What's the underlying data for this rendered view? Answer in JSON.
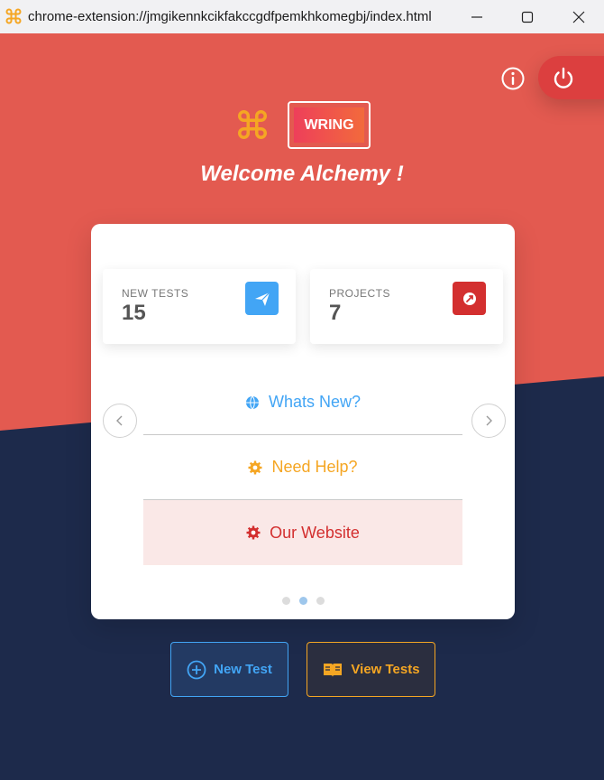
{
  "window": {
    "url": "chrome-extension://jmgikennkcikfakccgdfpemkhkomegbj/index.html",
    "icons": [
      "app-command-icon",
      "minimize-icon",
      "maximize-icon",
      "close-icon"
    ]
  },
  "header": {
    "brand": "WRING",
    "welcome": "Welcome Alchemy !",
    "icons": [
      "info-icon",
      "power-icon",
      "command-logo-icon"
    ]
  },
  "stats": [
    {
      "label": "NEW TESTS",
      "value": "15",
      "icon": "paper-plane-icon",
      "color": "#42a5f5"
    },
    {
      "label": "PROJECTS",
      "value": "7",
      "icon": "rocket-icon",
      "color": "#d32f2f"
    }
  ],
  "menu": [
    {
      "label": "Whats New?",
      "icon": "globe-icon",
      "color": "#42a5f5"
    },
    {
      "label": "Need Help?",
      "icon": "gear-icon",
      "color": "#f5a623"
    },
    {
      "label": "Our Website",
      "icon": "gear-icon",
      "color": "#d32f2f"
    }
  ],
  "carousel": {
    "slides": 3,
    "active_slide": 2
  },
  "actions": [
    {
      "label": "New Test",
      "icon": "plus-circle-icon",
      "color": "#42a5f5"
    },
    {
      "label": "View Tests",
      "icon": "book-icon",
      "color": "#f5a623"
    }
  ],
  "colors": {
    "primary_red": "#e35a50",
    "navy": "#1d2a4b",
    "blue": "#42a5f5",
    "orange": "#f5a623"
  }
}
